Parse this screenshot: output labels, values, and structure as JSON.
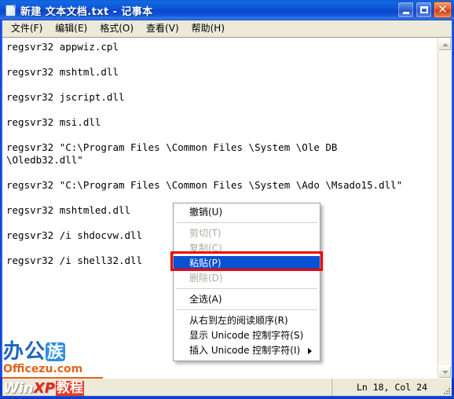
{
  "window": {
    "title": "新建 文本文档.txt - 记事本",
    "icon": "notepad-document-icon",
    "controls": {
      "minimize": "_",
      "maximize": "□",
      "close": "✕"
    }
  },
  "menubar": {
    "items": [
      {
        "label": "文件(F)",
        "text": "文件",
        "key": "F"
      },
      {
        "label": "编辑(E)",
        "text": "编辑",
        "key": "E"
      },
      {
        "label": "格式(O)",
        "text": "格式",
        "key": "O"
      },
      {
        "label": "查看(V)",
        "text": "查看",
        "key": "V"
      },
      {
        "label": "帮助(H)",
        "text": "帮助",
        "key": "H"
      }
    ]
  },
  "editor": {
    "lines": [
      "regsvr32 appwiz.cpl",
      "",
      "regsvr32 mshtml.dll",
      "",
      "regsvr32 jscript.dll",
      "",
      "regsvr32 msi.dll",
      "",
      "regsvr32 \"C:\\Program Files \\Common Files \\System \\Ole DB",
      "\\Oledb32.dll\"",
      "",
      "regsvr32 \"C:\\Program Files \\Common Files \\System \\Ado \\Msado15.dll\"",
      "",
      "regsvr32 mshtmled.dll",
      "",
      "regsvr32 /i shdocvw.dll",
      "",
      "regsvr32 /i shell32.dll"
    ]
  },
  "scrollbar": {
    "up_arrow": "scroll-up-arrow-icon",
    "down_arrow": "scroll-down-arrow-icon"
  },
  "statusbar": {
    "position": "Ln 18, Col 24"
  },
  "context_menu": {
    "items": [
      {
        "label": "撤销(U)",
        "text": "撤销",
        "key": "U",
        "state": "enabled",
        "separator_after": true
      },
      {
        "label": "剪切(T)",
        "text": "剪切",
        "key": "T",
        "state": "disabled",
        "separator_after": false
      },
      {
        "label": "复制(C)",
        "text": "复制",
        "key": "C",
        "state": "disabled",
        "separator_after": false
      },
      {
        "label": "粘贴(P)",
        "text": "粘贴",
        "key": "P",
        "state": "selected",
        "separator_after": false
      },
      {
        "label": "删除(D)",
        "text": "删除",
        "key": "D",
        "state": "disabled",
        "separator_after": true
      },
      {
        "label": "全选(A)",
        "text": "全选",
        "key": "A",
        "state": "enabled",
        "separator_after": true
      },
      {
        "label": "从右到左的阅读顺序(R)",
        "text": "从右到左的阅读顺序",
        "key": "R",
        "state": "enabled",
        "separator_after": false
      },
      {
        "label": "显示 Unicode 控制字符(S)",
        "text": "显示 Unicode 控制字符",
        "key": "S",
        "state": "enabled",
        "separator_after": false
      },
      {
        "label": "插入 Unicode 控制字符(I)",
        "text": "插入 Unicode 控制字符",
        "key": "I",
        "state": "enabled",
        "submenu": true,
        "separator_after": false
      }
    ],
    "highlight_color": "#0a50d2",
    "annotation_color": "#ee0000"
  },
  "watermarks": {
    "officezu": {
      "char1": "办",
      "char2": "公",
      "char3": "族",
      "latin": "Officezu.com"
    },
    "winxp": {
      "win": "Win",
      "xp": "XP",
      "jiaocheng": "教程"
    }
  },
  "colors": {
    "titlebar_blue": "#0d57d8",
    "menu_bg": "#ece9d8",
    "selection_blue": "#0a50d2",
    "annotation_red": "#ee0000",
    "brand_blue": "#1b64c4",
    "brand_orange": "#e2651a"
  }
}
